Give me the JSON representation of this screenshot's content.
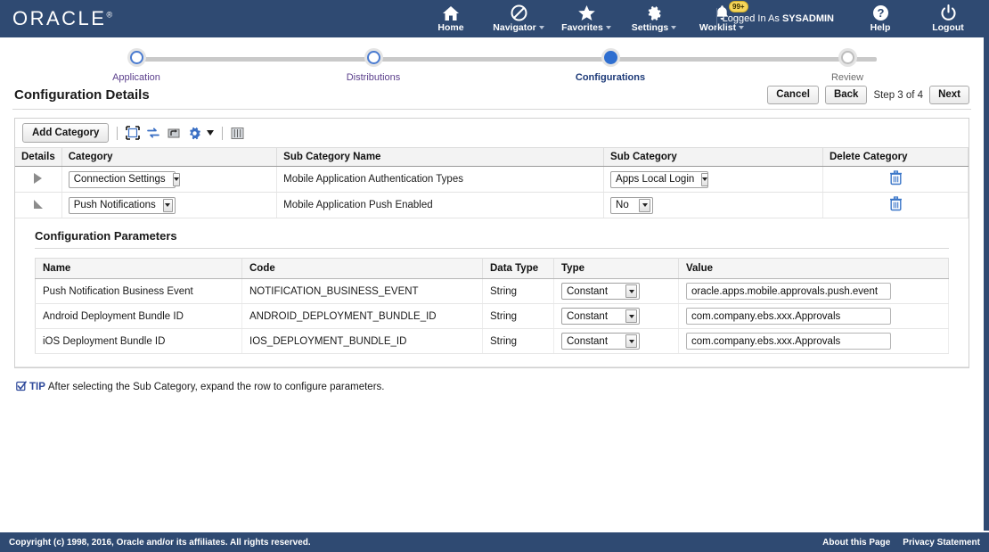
{
  "header": {
    "logo": "ORACLE",
    "logo_tm": "®",
    "nav": [
      {
        "label": "Home",
        "icon": "home-icon",
        "has_caret": false,
        "badge": null
      },
      {
        "label": "Navigator",
        "icon": "navigator-icon",
        "has_caret": true,
        "badge": null
      },
      {
        "label": "Favorites",
        "icon": "star-icon",
        "has_caret": true,
        "badge": null
      },
      {
        "label": "Settings",
        "icon": "gear-icon",
        "has_caret": true,
        "badge": null
      },
      {
        "label": "Worklist",
        "icon": "bell-icon",
        "has_caret": true,
        "badge": "99+"
      }
    ],
    "logged_in_prefix": "Logged In As ",
    "logged_in_user": "SYSADMIN",
    "help_label": "Help",
    "logout_label": "Logout"
  },
  "train": {
    "steps": [
      {
        "label": "Application",
        "state": "visited"
      },
      {
        "label": "Distributions",
        "state": "visited"
      },
      {
        "label": "Configurations",
        "state": "active"
      },
      {
        "label": "Review",
        "state": "inactive"
      }
    ]
  },
  "title_bar": {
    "title": "Configuration Details",
    "cancel_label": "Cancel",
    "back_label": "Back",
    "step_indicator": "Step 3 of 4",
    "next_label": "Next"
  },
  "toolbar": {
    "add_category_label": "Add Category",
    "icons": [
      {
        "name": "detach-icon"
      },
      {
        "name": "refresh-icon"
      },
      {
        "name": "export-icon"
      },
      {
        "name": "gear-icon"
      },
      {
        "name": "columns-icon"
      }
    ]
  },
  "grid": {
    "columns": [
      "Details",
      "Category",
      "Sub Category Name",
      "Sub Category",
      "Delete Category"
    ],
    "rows": [
      {
        "expander": "collapsed",
        "category": "Connection Settings",
        "sub_category_name": "Mobile Application Authentication Types",
        "sub_category": "Apps Local Login",
        "delete_icon": "trash-icon"
      },
      {
        "expander": "expanded",
        "category": "Push Notifications",
        "sub_category_name": "Mobile Application Push Enabled",
        "sub_category": "No",
        "delete_icon": "trash-icon"
      }
    ]
  },
  "detail": {
    "title": "Configuration Parameters",
    "columns": [
      "Name",
      "Code",
      "Data Type",
      "Type",
      "Value"
    ],
    "rows": [
      {
        "name": "Push Notification Business Event",
        "code": "NOTIFICATION_BUSINESS_EVENT",
        "data_type": "String",
        "type": "Constant",
        "value": "oracle.apps.mobile.approvals.push.event"
      },
      {
        "name": "Android Deployment Bundle ID",
        "code": "ANDROID_DEPLOYMENT_BUNDLE_ID",
        "data_type": "String",
        "type": "Constant",
        "value": "com.company.ebs.xxx.Approvals"
      },
      {
        "name": "iOS Deployment Bundle ID",
        "code": "IOS_DEPLOYMENT_BUNDLE_ID",
        "data_type": "String",
        "type": "Constant",
        "value": "com.company.ebs.xxx.Approvals"
      }
    ]
  },
  "tip": {
    "icon": "tip-check-icon",
    "word": "TIP",
    "text": " After selecting the Sub Category, expand the row to configure parameters."
  },
  "footer": {
    "copyright": "Copyright (c) 1998, 2016, Oracle and/or its affiliates. All rights reserved.",
    "about_label": "About this Page",
    "privacy_label": "Privacy Statement"
  },
  "colors": {
    "header_bg": "#2f4a72",
    "accent_blue": "#2f6fd0",
    "visited_link": "#5b3f8c",
    "badge_yellow": "#f5d55a"
  }
}
